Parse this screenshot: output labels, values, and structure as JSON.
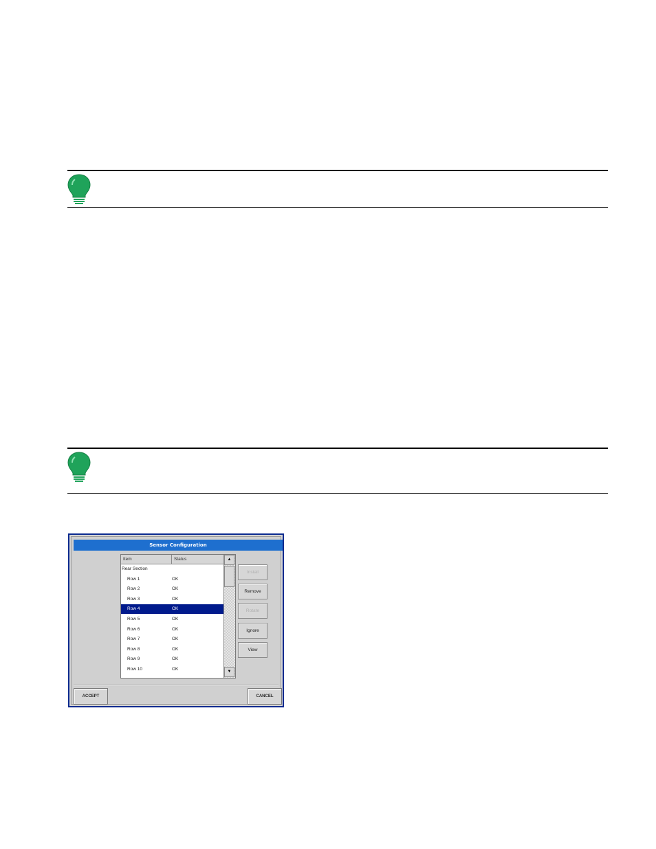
{
  "dialog": {
    "title": "Sensor Configuration",
    "columns": [
      "Item",
      "Status"
    ],
    "rows": [
      {
        "item": "Rear Section",
        "status": "",
        "root": true,
        "selected": false
      },
      {
        "item": "Row 1",
        "status": "OK",
        "root": false,
        "selected": false
      },
      {
        "item": "Row 2",
        "status": "OK",
        "root": false,
        "selected": false
      },
      {
        "item": "Row 3",
        "status": "OK",
        "root": false,
        "selected": false
      },
      {
        "item": "Row 4",
        "status": "OK",
        "root": false,
        "selected": true
      },
      {
        "item": "Row 5",
        "status": "OK",
        "root": false,
        "selected": false
      },
      {
        "item": "Row 6",
        "status": "OK",
        "root": false,
        "selected": false
      },
      {
        "item": "Row 7",
        "status": "OK",
        "root": false,
        "selected": false
      },
      {
        "item": "Row 8",
        "status": "OK",
        "root": false,
        "selected": false
      },
      {
        "item": "Row 9",
        "status": "OK",
        "root": false,
        "selected": false
      },
      {
        "item": "Row 10",
        "status": "OK",
        "root": false,
        "selected": false
      }
    ],
    "side_buttons": [
      {
        "label": "Install",
        "enabled": false
      },
      {
        "label": "Remove",
        "enabled": true
      },
      {
        "label": "Rotate",
        "enabled": false
      },
      {
        "label": "Ignore",
        "enabled": true
      },
      {
        "label": "View",
        "enabled": true
      }
    ],
    "accept_label": "ACCEPT",
    "cancel_label": "CANCEL",
    "scroll_up_glyph": "▲",
    "scroll_down_glyph": "▼"
  },
  "colors": {
    "title_bar": "#1e6fcf",
    "selection": "#001a8c",
    "note_icon": "#1fa35a",
    "dialog_border": "#0b2a8f"
  },
  "icons": [
    "lightbulb-note-icon",
    "scroll-up-icon",
    "scroll-down-icon"
  ]
}
